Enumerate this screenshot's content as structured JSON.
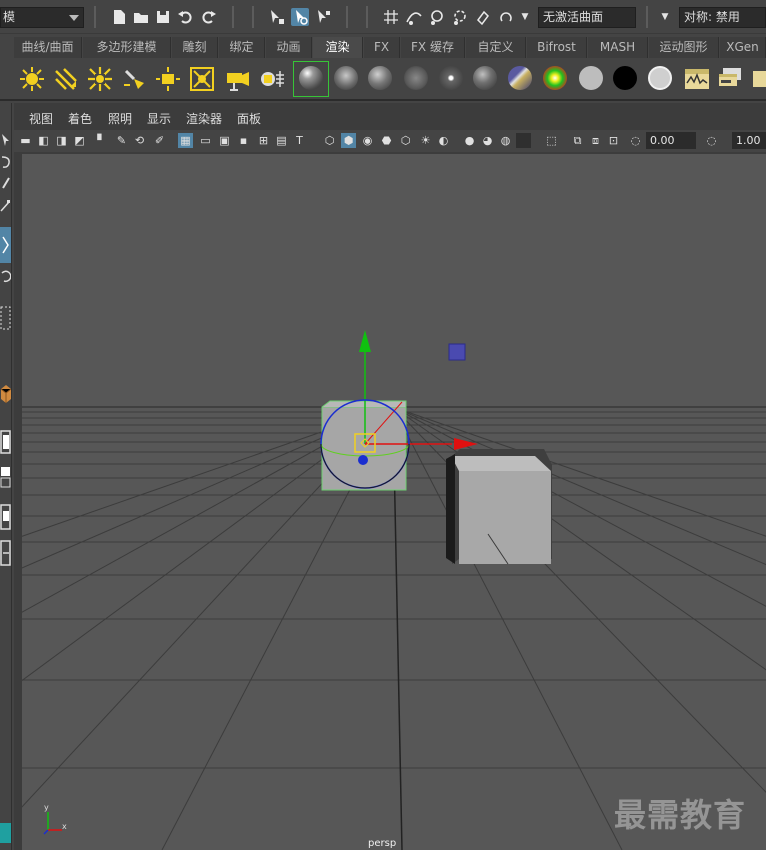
{
  "status_line": {
    "mode_value": "模",
    "live_surface_value": "无激活曲面",
    "symmetry_label": "对称: 禁用"
  },
  "shelf_tabs": [
    {
      "label": "曲线/曲面",
      "active": false
    },
    {
      "label": "多边形建模",
      "active": false
    },
    {
      "label": "雕刻",
      "active": false
    },
    {
      "label": "绑定",
      "active": false
    },
    {
      "label": "动画",
      "active": false
    },
    {
      "label": "渲染",
      "active": true
    },
    {
      "label": "FX",
      "active": false
    },
    {
      "label": "FX 缓存",
      "active": false
    },
    {
      "label": "自定义",
      "active": false
    },
    {
      "label": "Bifrost",
      "active": false
    },
    {
      "label": "MASH",
      "active": false
    },
    {
      "label": "运动图形",
      "active": false
    },
    {
      "label": "XGen",
      "active": false
    }
  ],
  "shelf_icons": [
    "point-light-icon",
    "directional-light-icon",
    "spot-light-icon",
    "area-light-icon",
    "volume-light-icon",
    "ambient-light-icon",
    "camera-icon",
    "camera-aim-icon",
    "blinn-sphere-icon",
    "lambert-sphere-icon",
    "phong-sphere-icon",
    "phonge-sphere-icon",
    "anisotropic-sphere-icon",
    "surface-shader-icon",
    "layered-shader-icon",
    "ramp-shader-icon",
    "white-sphere-icon",
    "black-sphere-icon",
    "light-gray-sphere-icon",
    "render-view-icon",
    "render-settings-icon"
  ],
  "panel_menu": [
    "视图",
    "着色",
    "照明",
    "显示",
    "渲染器",
    "面板"
  ],
  "panel_toolbar": {
    "gamma_value": "0.00",
    "exposure_value": "1.00"
  },
  "viewport": {
    "camera_label": "persp",
    "watermark": "最需教育",
    "axis_x": "x",
    "axis_y": "y",
    "colors": {
      "background": "#575757",
      "grid": "#3a3a3a",
      "move_x": "#e01010",
      "move_y": "#10c010",
      "rotate_circle": "#1a2ed0",
      "cube": "#a8a8a8"
    }
  }
}
